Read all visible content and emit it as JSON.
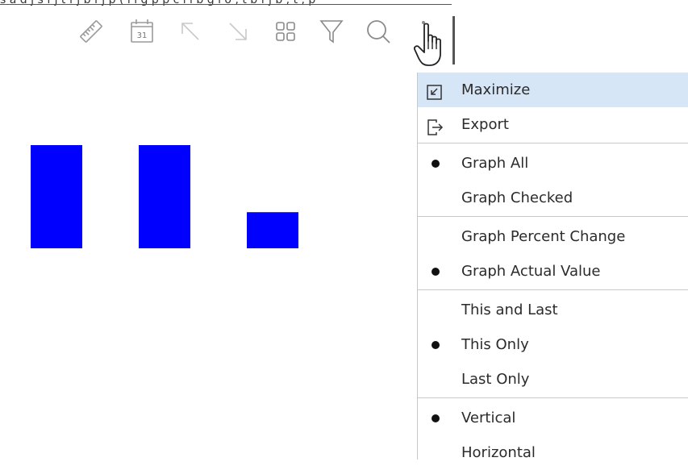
{
  "top_strip": {
    "text_before": "s a d j  s f j  t f j b f j p ( l i g  p  p  c",
    "text_link": "l i b  g i o",
    "text_after": ", t  b  f j b ,  t , p"
  },
  "toolbar": {
    "icons": [
      "ruler-icon",
      "calendar-icon",
      "arrow-up-left-icon",
      "arrow-down-right-icon",
      "grid-icon",
      "filter-icon",
      "search-icon",
      "more-vertical-icon"
    ],
    "calendar_day": "31"
  },
  "chart_data": {
    "type": "bar",
    "categories": [
      "",
      "",
      ""
    ],
    "values": [
      100,
      100,
      35
    ],
    "ylim": [
      0,
      100
    ],
    "bar_color": "#0000ff",
    "grid": false,
    "legend": "none"
  },
  "menu": {
    "groups": [
      {
        "items": [
          {
            "label": "Maximize",
            "icon": "maximize-icon",
            "highlighted": true
          },
          {
            "label": "Export",
            "icon": "export-icon",
            "highlighted": false
          }
        ]
      },
      {
        "items": [
          {
            "label": "Graph All",
            "checked": true
          },
          {
            "label": "Graph Checked",
            "checked": false
          }
        ]
      },
      {
        "items": [
          {
            "label": "Graph Percent Change",
            "checked": false
          },
          {
            "label": "Graph Actual Value",
            "checked": true
          }
        ]
      },
      {
        "items": [
          {
            "label": "This and Last",
            "checked": false
          },
          {
            "label": "This Only",
            "checked": true
          },
          {
            "label": "Last Only",
            "checked": false
          }
        ]
      },
      {
        "items": [
          {
            "label": "Vertical",
            "checked": true
          },
          {
            "label": "Horizontal",
            "checked": false
          }
        ]
      }
    ],
    "highlight_color": "#d6e6f6"
  }
}
